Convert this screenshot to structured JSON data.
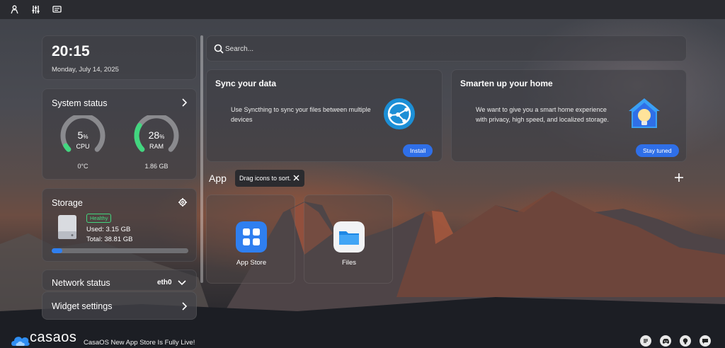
{
  "clock": {
    "time": "20:15",
    "date": "Monday, July 14, 2025"
  },
  "system_status": {
    "title": "System status",
    "cpu": {
      "value": "5",
      "unit": "%",
      "label": "CPU",
      "sub": "0°C",
      "percent": 5
    },
    "ram": {
      "value": "28",
      "unit": "%",
      "label": "RAM",
      "sub": "1.86 GB",
      "percent": 28
    }
  },
  "storage": {
    "title": "Storage",
    "badge": "Healthy",
    "used": "Used: 3.15 GB",
    "total": "Total: 38.81 GB",
    "used_fraction": 0.08
  },
  "network": {
    "title": "Network status",
    "interface": "eth0"
  },
  "widget_settings": {
    "label": "Widget settings"
  },
  "search": {
    "placeholder": "Search..."
  },
  "promos": [
    {
      "title": "Sync your data",
      "desc": "Use Syncthing to sync your files between multiple devices",
      "button": "Install"
    },
    {
      "title": "Smarten up your home",
      "desc": "We want to give you a smart home experience with privacy, high speed, and localized storage.",
      "button": "Stay tuned"
    }
  ],
  "apps_section": {
    "title": "App",
    "tooltip": "Drag icons to sort."
  },
  "apps": [
    {
      "name": "App Store"
    },
    {
      "name": "Files"
    }
  ],
  "footer": {
    "logo": "casaos",
    "news": "CasaOS New App Store Is Fully Live!"
  },
  "colors": {
    "accent": "#2f6fe8",
    "gauge_green": "#42d67f",
    "healthy": "#42d67f"
  },
  "icons": [
    "user-icon",
    "sliders-icon",
    "terminal-icon",
    "search-icon",
    "chevron-right-icon",
    "gear-icon",
    "close-icon",
    "plus-icon",
    "disk-icon",
    "syncthing-icon",
    "smart-home-icon",
    "app-store-icon",
    "folder-icon",
    "discord-icon",
    "github-icon",
    "chat-icon"
  ]
}
